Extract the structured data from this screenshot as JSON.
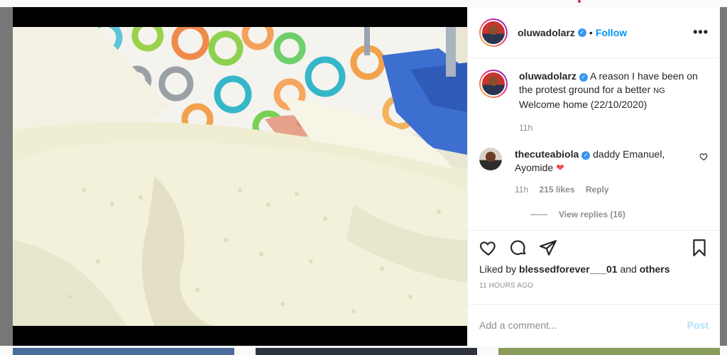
{
  "post": {
    "username": "oluwadolarz",
    "follow_label": "Follow",
    "separator": "•",
    "more_label": "•••",
    "caption_line1": "A reason I have been on the protest ground for a better",
    "caption_flag": "NG",
    "caption_line2": "Welcome home (22/10/2020)",
    "caption_time": "11h"
  },
  "comment": {
    "username": "thecuteabiola",
    "text": "daddy Emanuel, Ayomide",
    "emoji": "❤",
    "time": "11h",
    "likes": "215 likes",
    "reply_label": "Reply",
    "view_replies": "View replies (16)"
  },
  "engagement": {
    "liked_by_prefix": "Liked by",
    "liked_by_user": "blessedforever___01",
    "and_word": "and",
    "others_label": "others",
    "timestamp": "11 HOURS AGO"
  },
  "composer": {
    "placeholder": "Add a comment...",
    "post_label": "Post"
  },
  "icons": {
    "verified": "verified-badge-icon",
    "like": "heart-icon",
    "comment": "comment-bubble-icon",
    "share": "paper-plane-icon",
    "save": "bookmark-icon"
  },
  "colors": {
    "accent_blue": "#0095f6",
    "verified_blue": "#3897f0",
    "heart_red": "#ed4956",
    "muted_text": "#8e8e8e",
    "post_disabled": "#b2dffc"
  }
}
